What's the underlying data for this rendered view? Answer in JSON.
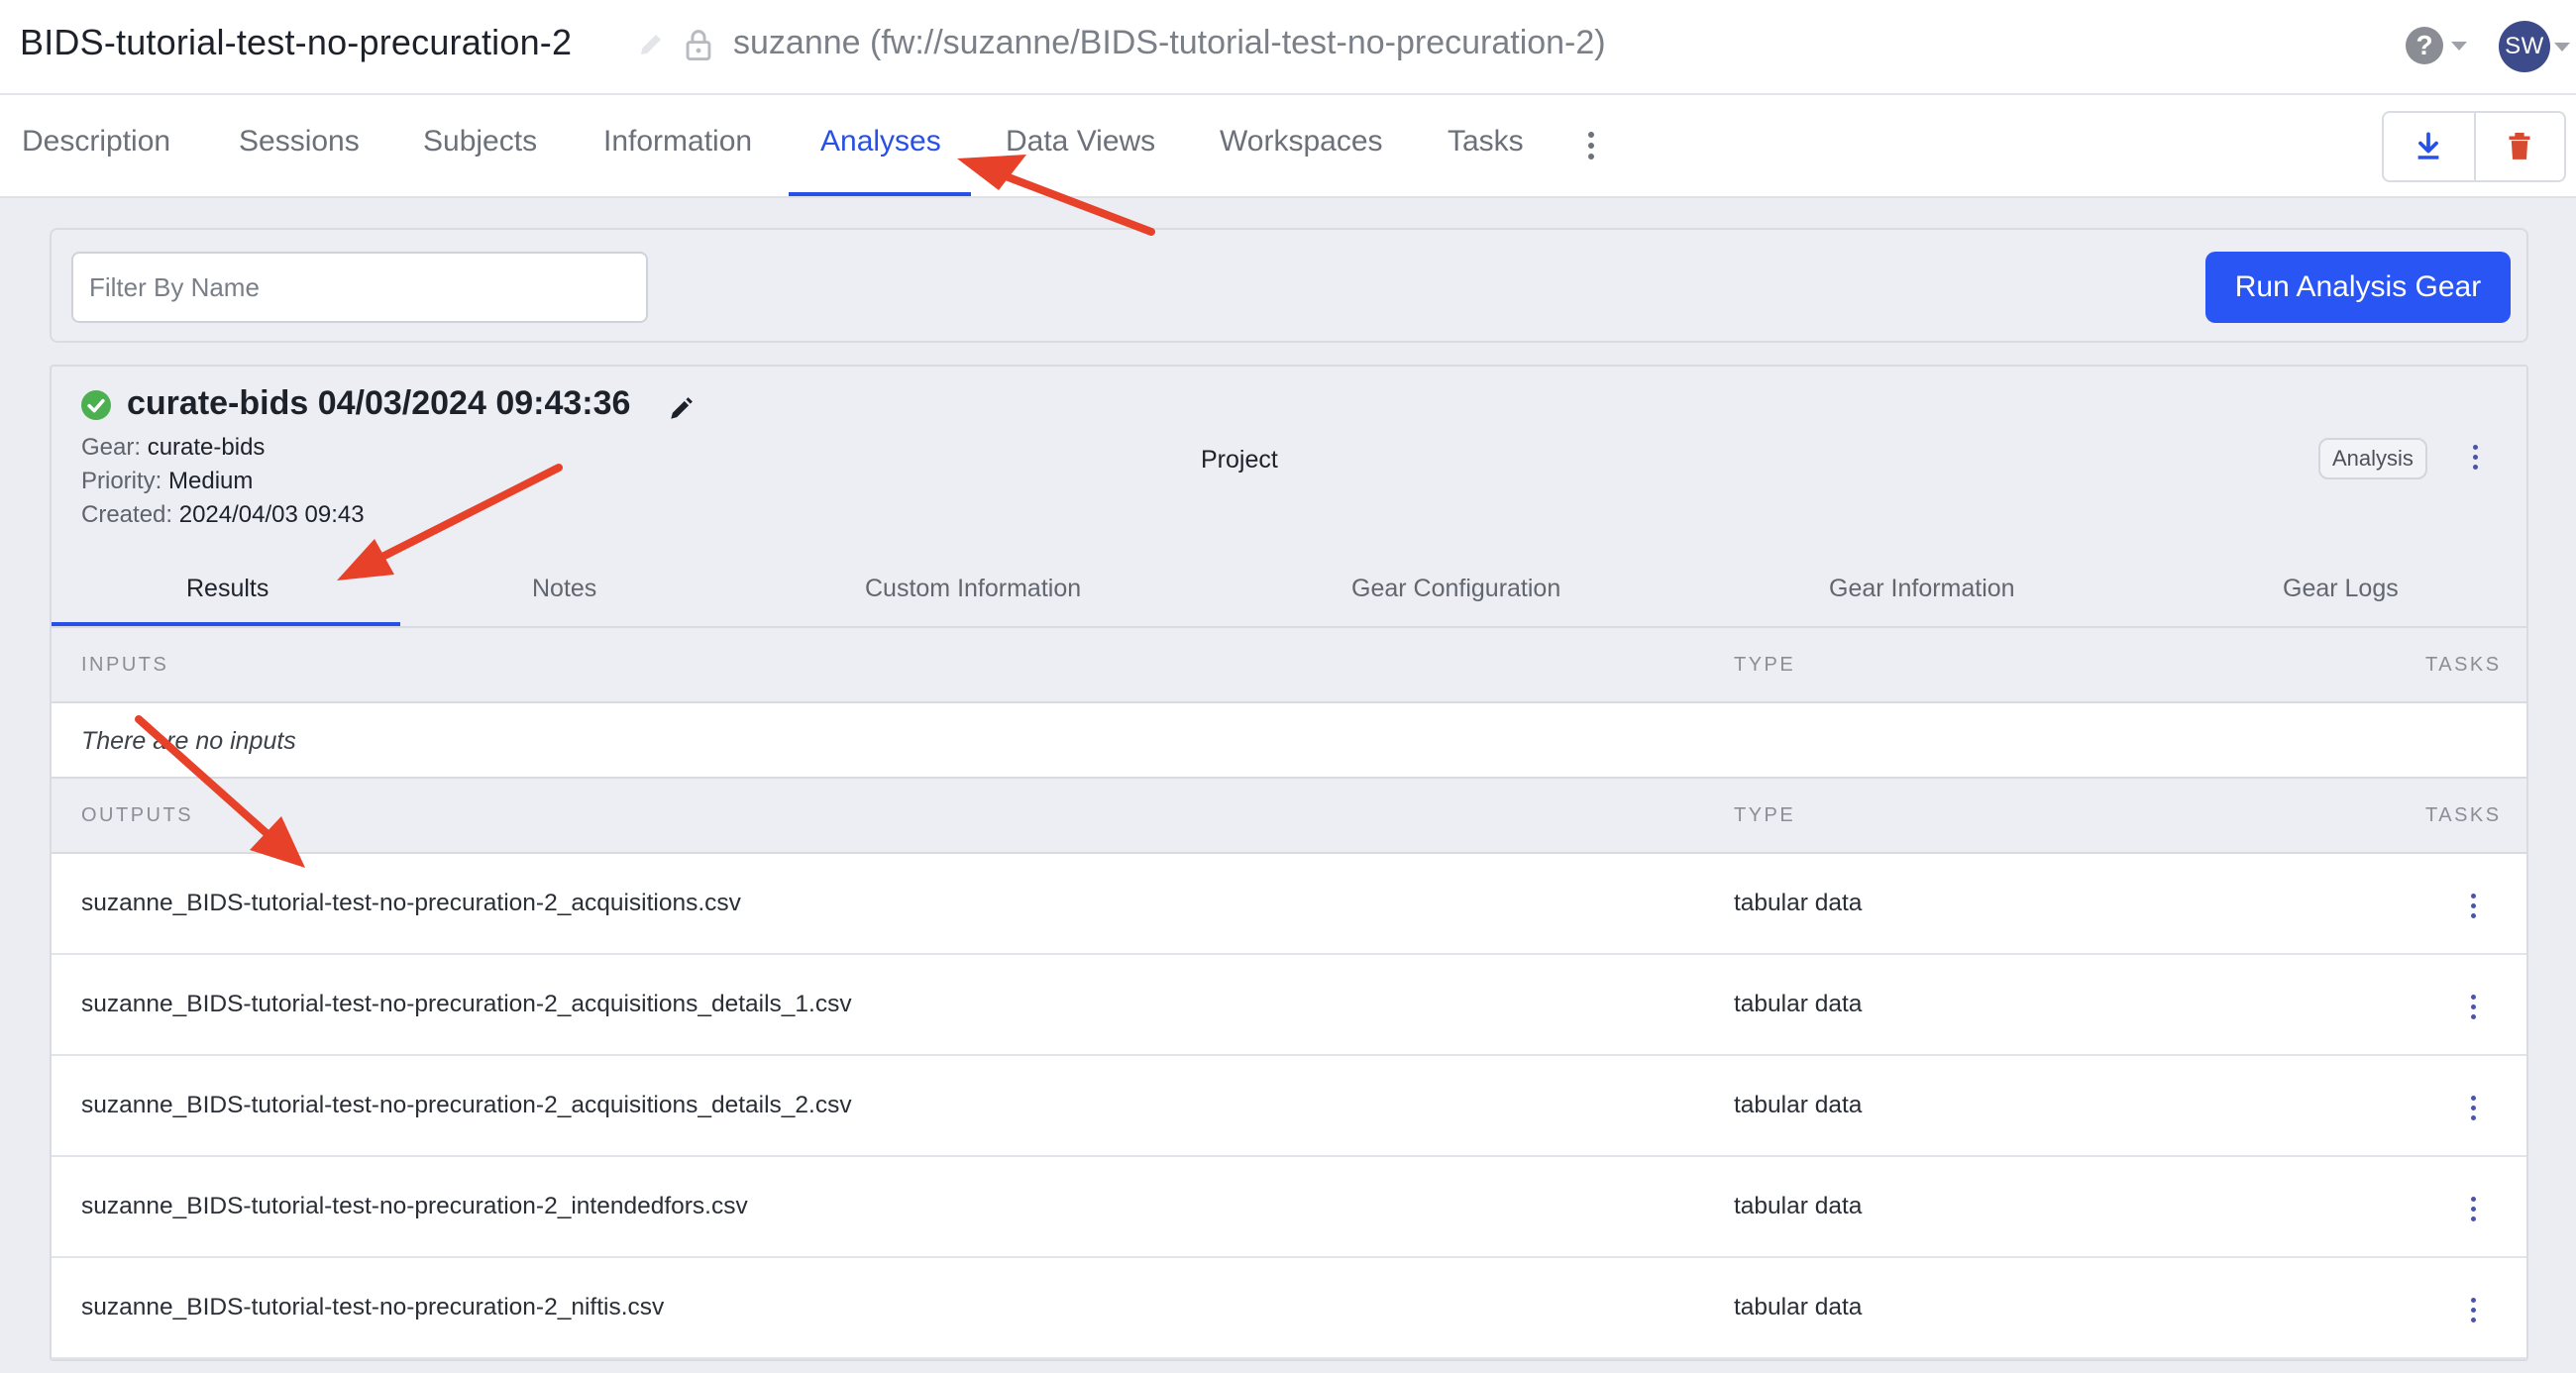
{
  "header": {
    "project_title": "BIDS-tutorial-test-no-precuration-2",
    "project_path": "suzanne (fw://suzanne/BIDS-tutorial-test-no-precuration-2)",
    "help_label": "?",
    "avatar_initials": "SW"
  },
  "tabs": [
    {
      "label": "Description"
    },
    {
      "label": "Sessions"
    },
    {
      "label": "Subjects"
    },
    {
      "label": "Information"
    },
    {
      "label": "Analyses",
      "active": true
    },
    {
      "label": "Data Views"
    },
    {
      "label": "Workspaces"
    },
    {
      "label": "Tasks"
    }
  ],
  "toolbar": {
    "download_icon": "download-icon",
    "delete_icon": "trash-icon"
  },
  "filter": {
    "placeholder": "Filter By Name",
    "value": ""
  },
  "run_button": "Run Analysis Gear",
  "analysis": {
    "status": "complete",
    "title": "curate-bids 04/03/2024 09:43:36",
    "gear_label": "Gear:",
    "gear_value": "curate-bids",
    "priority_label": "Priority:",
    "priority_value": "Medium",
    "created_label": "Created:",
    "created_value": "2024/04/03 09:43",
    "parent": "Project",
    "type_badge": "Analysis"
  },
  "subtabs": [
    {
      "label": "Results",
      "active": true
    },
    {
      "label": "Notes"
    },
    {
      "label": "Custom Information"
    },
    {
      "label": "Gear Configuration"
    },
    {
      "label": "Gear Information"
    },
    {
      "label": "Gear Logs"
    }
  ],
  "inputs": {
    "header": "INPUTS",
    "type_header": "TYPE",
    "tasks_header": "TASKS",
    "empty_text": "There are no inputs"
  },
  "outputs": {
    "header": "OUTPUTS",
    "type_header": "TYPE",
    "tasks_header": "TASKS",
    "rows": [
      {
        "name": "suzanne_BIDS-tutorial-test-no-precuration-2_acquisitions.csv",
        "type": "tabular data"
      },
      {
        "name": "suzanne_BIDS-tutorial-test-no-precuration-2_acquisitions_details_1.csv",
        "type": "tabular data"
      },
      {
        "name": "suzanne_BIDS-tutorial-test-no-precuration-2_acquisitions_details_2.csv",
        "type": "tabular data"
      },
      {
        "name": "suzanne_BIDS-tutorial-test-no-precuration-2_intendedfors.csv",
        "type": "tabular data"
      },
      {
        "name": "suzanne_BIDS-tutorial-test-no-precuration-2_niftis.csv",
        "type": "tabular data"
      }
    ]
  },
  "colors": {
    "accent": "#2750e6",
    "run_button": "#2a55f5",
    "success": "#4caf50",
    "delete": "#d64a2f",
    "annotation_arrow": "#e8412a"
  }
}
